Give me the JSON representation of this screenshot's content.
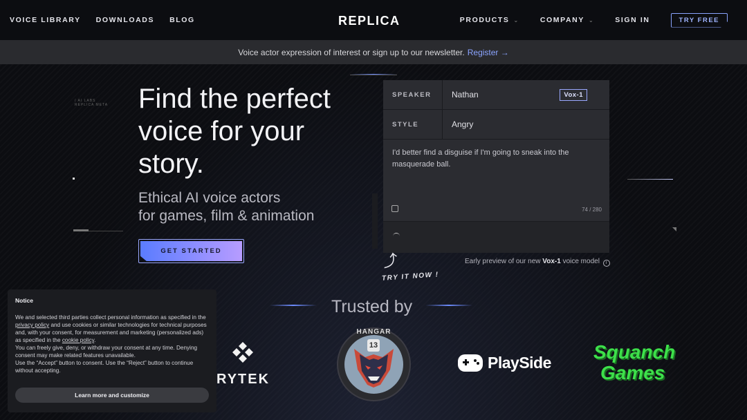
{
  "nav": {
    "left": [
      "VOICE LIBRARY",
      "DOWNLOADS",
      "BLOG"
    ],
    "logo": "REPLICA",
    "right": {
      "products": "PRODUCTS",
      "company": "COMPANY",
      "sign_in": "SIGN IN",
      "try_free": "TRY FREE"
    }
  },
  "banner": {
    "text": "Voice actor expression of interest or sign up to our newsletter.",
    "link": "Register →"
  },
  "deco": {
    "label_top": "/ AI LABS",
    "label_bottom": "REPLICA META"
  },
  "hero": {
    "title": "Find the perfect voice for your story.",
    "subtitle_line1": "Ethical AI voice actors",
    "subtitle_line2": "for games, film & animation",
    "cta": "GET STARTED"
  },
  "demo": {
    "speaker_label": "SPEAKER",
    "speaker_value": "Nathan",
    "model_badge": "Vox-1",
    "style_label": "STYLE",
    "style_value": "Angry",
    "text": "I'd better find a disguise if I'm going to sneak into the masquerade ball.",
    "char_count": "74 / 280",
    "early_preview_prefix": "Early preview of our new",
    "early_preview_model": "Vox-1",
    "early_preview_suffix": "voice model",
    "try_it_now": "TRY IT NOW !"
  },
  "trusted": {
    "heading": "Trusted by",
    "logos": {
      "crytek": "RYTEK",
      "hangar": "HANGAR",
      "hangar_number": "13",
      "playside": "PlaySide",
      "squanch_line1": "Squanch",
      "squanch_line2": "Games"
    }
  },
  "cookie": {
    "title": "Notice",
    "p1_a": "We and selected third parties collect personal information as specified in the",
    "privacy_link": "privacy policy",
    "p1_b": "and use cookies or similar technologies for technical purposes and, with your consent, for measurement and marketing (personalized ads) as specified in the",
    "cookie_link": "cookie policy",
    "p2": "You can freely give, deny, or withdraw your consent at any time. Denying consent may make related features unavailable.",
    "p3": "Use the “Accept” button to consent. Use the “Reject” button to continue without accepting.",
    "button": "Learn more and customize"
  },
  "colors": {
    "accent": "#8ba4ff",
    "background": "#0c0d11",
    "squanch_green": "#3de04a"
  }
}
